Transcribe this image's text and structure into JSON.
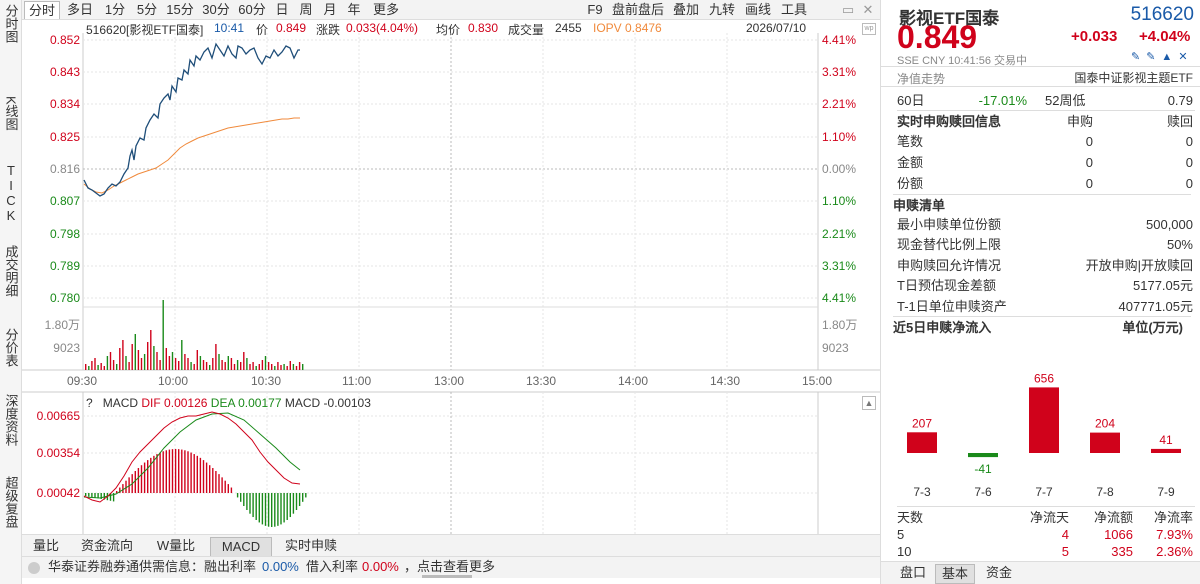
{
  "nav": {
    "items": [
      "分时图",
      "K线图",
      "TICK",
      "成交明细",
      "分价表",
      "深度资料",
      "超级复盘"
    ]
  },
  "period_tabs": [
    "分时",
    "多日",
    "1分",
    "5分",
    "15分",
    "30分",
    "60分",
    "日",
    "周",
    "月",
    "年",
    "更多"
  ],
  "right_tools": [
    "F9",
    "盘前盘后",
    "叠加",
    "九转",
    "画线",
    "工具"
  ],
  "info": {
    "code_name": "516620[影视ETF国泰]",
    "time": "10:41",
    "price_label": "价",
    "price": "0.849",
    "change_label": "涨跌",
    "change": "0.033(4.04%)",
    "avg_label": "均价",
    "avg": "0.830",
    "volume_label": "成交量",
    "volume": "2455",
    "iopv": "IOPV 0.8476",
    "date": "2026/07/10"
  },
  "price_axis": {
    "left": [
      "0.852",
      "0.843",
      "0.834",
      "0.825",
      "0.816",
      "0.807",
      "0.798",
      "0.789",
      "0.780"
    ],
    "right": [
      "4.41%",
      "3.31%",
      "2.21%",
      "1.10%",
      "0.00%",
      "1.10%",
      "2.21%",
      "3.31%",
      "4.41%"
    ]
  },
  "volume_axis": {
    "top": "1.80万",
    "mid": "9023"
  },
  "time_axis": [
    "09:30",
    "10:00",
    "10:30",
    "11:00",
    "13:00",
    "13:30",
    "14:00",
    "14:30",
    "15:00"
  ],
  "macd": {
    "question": "?",
    "name": "MACD",
    "dif": "DIF 0.00126",
    "dea": "DEA 0.00177",
    "macd": "MACD -0.00103",
    "axis": [
      "0.00665",
      "0.00354",
      "0.00042"
    ]
  },
  "bottom_tabs": [
    "量比",
    "资金流向",
    "W量比",
    "MACD",
    "实时申赎"
  ],
  "status": {
    "text1": "华泰证券融券通供需信息：融出利率",
    "rate1": "0.00%",
    "text2": "借入利率",
    "rate2": "0.00%",
    "text3": "，点击查看更多"
  },
  "quote": {
    "name": "影视ETF国泰",
    "code": "516620",
    "price": "0.849",
    "change": "+0.033",
    "pct": "+4.04%",
    "sub": "SSE CNY 10:41:56 交易中",
    "nav_label": "净值走势",
    "index_name": "国泰中证影视主题ETF"
  },
  "perf_row": {
    "c1": "60日",
    "c2": "-17.01%",
    "c3": "52周低",
    "c4": "0.79"
  },
  "realtime": {
    "title": "实时申购赎回信息",
    "col1": "申购",
    "col2": "赎回",
    "rows": [
      {
        "label": "笔数",
        "v1": "0",
        "v2": "0"
      },
      {
        "label": "金额",
        "v1": "0",
        "v2": "0"
      },
      {
        "label": "份额",
        "v1": "0",
        "v2": "0"
      }
    ]
  },
  "list": {
    "title": "申赎清单",
    "rows": [
      {
        "label": "最小申赎单位份额",
        "value": "500,000"
      },
      {
        "label": "现金替代比例上限",
        "value": "50%"
      },
      {
        "label": "申购赎回允许情况",
        "value": "开放申购|开放赎回"
      },
      {
        "label": "T日预估现金差额",
        "value": "5177.05元"
      },
      {
        "label": "T-1日单位申赎资产",
        "value": "407771.05元"
      }
    ]
  },
  "flow": {
    "title": "近5日申赎净流入",
    "unit": "单位(万元)",
    "chart_data": {
      "type": "bar",
      "categories": [
        "7-3",
        "7-6",
        "7-7",
        "7-8",
        "7-9"
      ],
      "values": [
        207,
        -41,
        656,
        204,
        41
      ],
      "title": "近5日申赎净流入",
      "ylabel": "单位(万元)"
    },
    "table_headers": [
      "天数",
      "净流天",
      "净流额",
      "净流率"
    ],
    "table_rows": [
      [
        "5",
        "4",
        "1066",
        "7.93%"
      ],
      [
        "10",
        "5",
        "335",
        "2.36%"
      ]
    ]
  },
  "right_bottom_tabs": [
    "盘口",
    "基本",
    "资金"
  ],
  "colors": {
    "up": "#d0021b",
    "down": "#1a8a1a",
    "price_line": "#1f4e79",
    "avg_line": "#f08a3c"
  }
}
